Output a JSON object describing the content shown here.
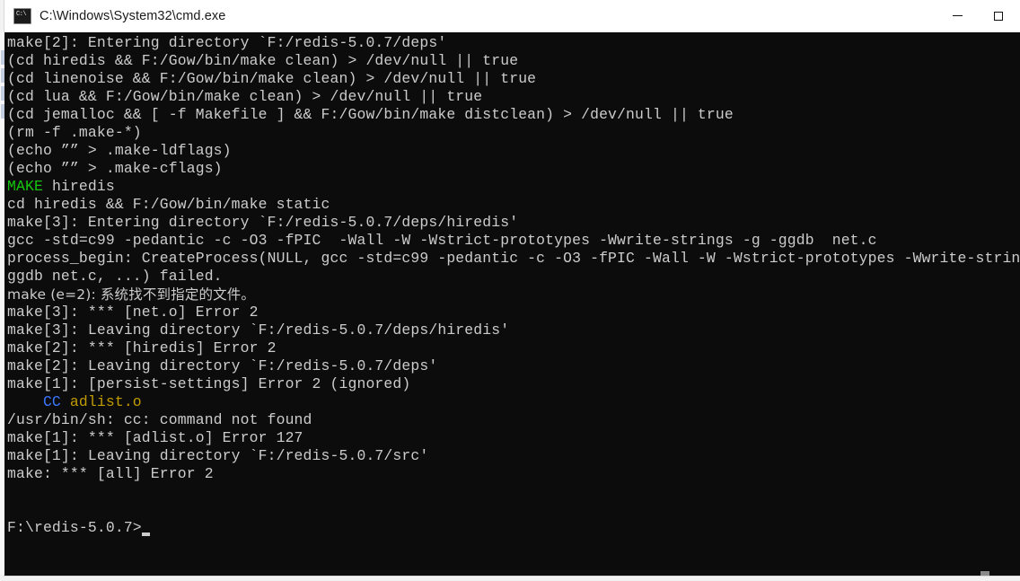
{
  "window": {
    "title": "C:\\Windows\\System32\\cmd.exe",
    "icon": "cmd-console-icon",
    "minimize_label": "Minimize",
    "maximize_label": "Maximize"
  },
  "theme": {
    "console_background": "#0c0c0c",
    "console_foreground": "#cccccc",
    "titlebar_background": "#ffffff",
    "titlebar_foreground": "#1a1a1a",
    "accent_green": "#16c60c",
    "accent_blue": "#3b78ff",
    "accent_yellow": "#c19c00"
  },
  "console": {
    "prompt": "F:\\redis-5.0.7>",
    "lines": [
      {
        "text": "make[2]: Entering directory `F:/redis-5.0.7/deps'"
      },
      {
        "text": "(cd hiredis && F:/Gow/bin/make clean) > /dev/null || true"
      },
      {
        "text": "(cd linenoise && F:/Gow/bin/make clean) > /dev/null || true"
      },
      {
        "text": "(cd lua && F:/Gow/bin/make clean) > /dev/null || true"
      },
      {
        "text": "(cd jemalloc && [ -f Makefile ] && F:/Gow/bin/make distclean) > /dev/null || true"
      },
      {
        "text": "(rm -f .make-*)"
      },
      {
        "text": "(echo ”” > .make-ldflags)"
      },
      {
        "text": "(echo ”” > .make-cflags)"
      },
      {
        "segments": [
          {
            "text": "MAKE",
            "color": "green"
          },
          {
            "text": " hiredis",
            "color": "default"
          }
        ]
      },
      {
        "text": "cd hiredis && F:/Gow/bin/make static"
      },
      {
        "text": "make[3]: Entering directory `F:/redis-5.0.7/deps/hiredis'"
      },
      {
        "text": "gcc -std=c99 -pedantic -c -O3 -fPIC  -Wall -W -Wstrict-prototypes -Wwrite-strings -g -ggdb  net.c"
      },
      {
        "text": "process_begin: CreateProcess(NULL, gcc -std=c99 -pedantic -c -O3 -fPIC -Wall -W -Wstrict-prototypes -Wwrite-strin"
      },
      {
        "text": "ggdb net.c, ...) failed."
      },
      {
        "text": "make (e=2): 系统找不到指定的文件。",
        "cjk": true
      },
      {
        "text": "make[3]: *** [net.o] Error 2"
      },
      {
        "text": "make[3]: Leaving directory `F:/redis-5.0.7/deps/hiredis'"
      },
      {
        "text": "make[2]: *** [hiredis] Error 2"
      },
      {
        "text": "make[2]: Leaving directory `F:/redis-5.0.7/deps'"
      },
      {
        "text": "make[1]: [persist-settings] Error 2 (ignored)"
      },
      {
        "segments": [
          {
            "text": "    CC",
            "color": "blue"
          },
          {
            "text": " adlist.o",
            "color": "yellow"
          }
        ]
      },
      {
        "text": "/usr/bin/sh: cc: command not found"
      },
      {
        "text": "make[1]: *** [adlist.o] Error 127"
      },
      {
        "text": "make[1]: Leaving directory `F:/redis-5.0.7/src'"
      },
      {
        "text": "make: *** [all] Error 2"
      },
      {
        "text": ""
      },
      {
        "text": ""
      },
      {
        "text": "F:\\redis-5.0.7>",
        "cursor": true
      }
    ]
  }
}
